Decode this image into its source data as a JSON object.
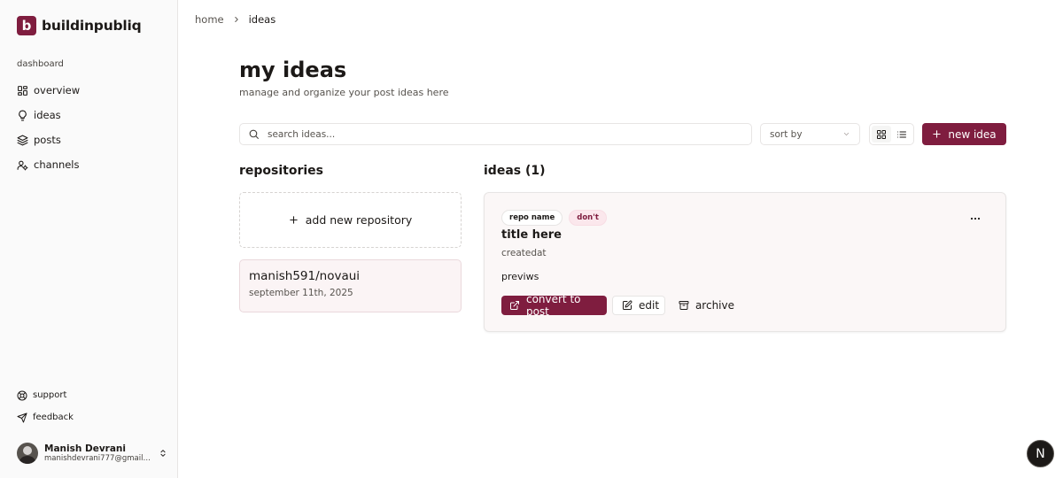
{
  "brand": {
    "logo_letter": "b",
    "name": "buildinpubliq",
    "accent": "#7f1d3f"
  },
  "sidebar": {
    "group_label": "dashboard",
    "items": [
      {
        "label": "overview",
        "icon": "layout-dashboard-icon"
      },
      {
        "label": "ideas",
        "icon": "lightbulb-icon"
      },
      {
        "label": "posts",
        "icon": "layers-icon"
      },
      {
        "label": "channels",
        "icon": "users-icon"
      }
    ],
    "footer_items": [
      {
        "label": "support",
        "icon": "lifebuoy-icon"
      },
      {
        "label": "feedback",
        "icon": "send-icon"
      }
    ],
    "user": {
      "name": "Manish Devrani",
      "email": "manishdevrani777@gmail.com"
    }
  },
  "breadcrumb": {
    "home": "home",
    "current": "ideas"
  },
  "header": {
    "title": "my ideas",
    "subtitle": "manage and organize your post ideas here"
  },
  "toolbar": {
    "search_placeholder": "search ideas...",
    "sort_label": "sort by",
    "new_idea_label": "new idea",
    "view_mode": "grid"
  },
  "repositories": {
    "title": "repositories",
    "add_label": "add new repository",
    "items": [
      {
        "name": "manish591/novaui",
        "date": "september 11th, 2025"
      }
    ]
  },
  "ideas": {
    "title": "ideas (1)",
    "items": [
      {
        "tags": [
          "repo name",
          "don't"
        ],
        "title": "title here",
        "created": "createdat",
        "preview": "previws",
        "actions": {
          "convert": "convert to post",
          "edit": "edit",
          "archive": "archive"
        }
      }
    ]
  },
  "fab": {
    "label": "N"
  }
}
